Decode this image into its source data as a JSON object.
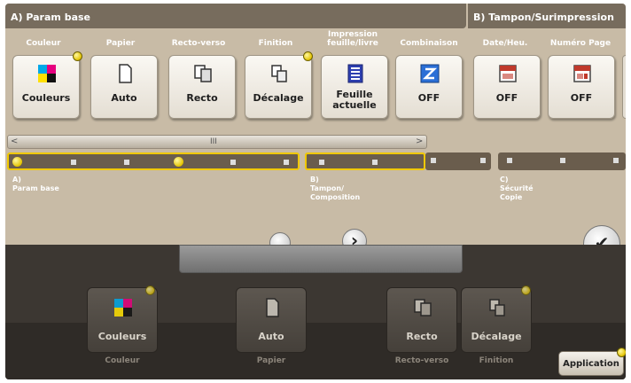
{
  "sections": {
    "a_title": "A)  Param base",
    "b_title": "B)  Tampon/Surimpression"
  },
  "functions": [
    {
      "label": "Couleur",
      "value": "Couleurs",
      "icon": "color-cmyk-icon"
    },
    {
      "label": "Papier",
      "value": "Auto",
      "icon": "paper-icon"
    },
    {
      "label": "Recto-verso",
      "value": "Recto",
      "icon": "simplex-icon"
    },
    {
      "label": "Finition",
      "value": "Décalage",
      "icon": "offset-icon"
    },
    {
      "label": "Impression feuille/livre",
      "value": "Feuille actuelle",
      "icon": "sheet-print-icon"
    },
    {
      "label": "Combinaison",
      "value": "OFF",
      "icon": "combination-icon"
    },
    {
      "label": "Date/Heu.",
      "value": "OFF",
      "icon": "date-stamp-icon"
    },
    {
      "label": "Numéro Page",
      "value": "OFF",
      "icon": "page-number-icon"
    }
  ],
  "scrollbar": {
    "left": "<",
    "grip": "III",
    "right": ">"
  },
  "tracks": {
    "a_label": "A)\nParam base",
    "b_label": "B)\nTampon/\nComposition",
    "c_label": "C)\nSécurité\nCopie"
  },
  "nav": {
    "next": "›",
    "ok": "✔"
  },
  "bottom": [
    {
      "value": "Couleurs",
      "caption": "Couleur"
    },
    {
      "value": "Auto",
      "caption": "Papier"
    },
    {
      "value": "Recto",
      "caption": "Recto-verso"
    },
    {
      "value": "Décalage",
      "caption": "Finition"
    }
  ],
  "application": "Application",
  "colors": {
    "accent_yellow": "#e3c300",
    "panel_beige": "#c8bba6",
    "header_brown": "#776c5d",
    "dark_panel": "#3c3732"
  }
}
